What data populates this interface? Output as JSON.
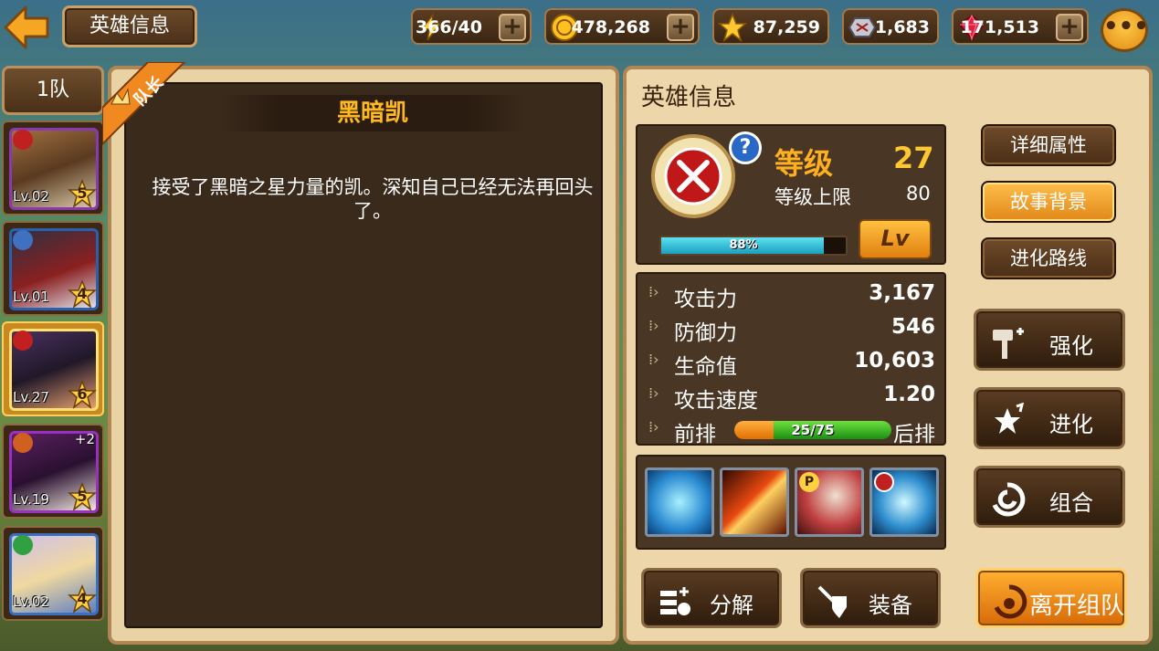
{
  "header": {
    "title": "英雄信息",
    "resources": {
      "stamina": "366/40",
      "gold": "478,268",
      "stars": "87,259",
      "crystal": "1,683",
      "ruby": "171,513"
    }
  },
  "sidebar": {
    "team_label": "1队",
    "heroes": [
      {
        "level": "Lv.02",
        "stars": "5",
        "extra": ""
      },
      {
        "level": "Lv.01",
        "stars": "4",
        "extra": ""
      },
      {
        "level": "Lv.27",
        "stars": "6",
        "extra": ""
      },
      {
        "level": "Lv.19",
        "stars": "5",
        "extra": "+2"
      },
      {
        "level": "Lv.02",
        "stars": "4",
        "extra": ""
      }
    ]
  },
  "story": {
    "captain_label": "队长",
    "hero_name": "黑暗凯",
    "text": "接受了黑暗之星力量的凯。深知自己已经无法再回头了。"
  },
  "info": {
    "title": "英雄信息",
    "level_label": "等级",
    "level_value": "27",
    "cap_label": "等级上限",
    "cap_value": "80",
    "xp_percent": "88%",
    "xp_fraction": 0.88,
    "lvup_label": "Lv",
    "stats": [
      {
        "label": "攻击力",
        "value": "3,167"
      },
      {
        "label": "防御力",
        "value": "546"
      },
      {
        "label": "生命值",
        "value": "10,603"
      },
      {
        "label": "攻击速度",
        "value": "1.20"
      }
    ],
    "position": {
      "front": "前排",
      "back": "后排",
      "value": "25/75",
      "front_fraction": 0.25
    }
  },
  "buttons": {
    "detail_attr": "详细属性",
    "story_bg": "故事背景",
    "evolve_route": "进化路线",
    "enhance": "强化",
    "evolve": "进化",
    "combine": "组合",
    "decompose": "分解",
    "equip": "装备",
    "leave_team": "离开组队"
  },
  "colors": {
    "accent": "#ffb820",
    "panel": "#ecd6aa",
    "dark_panel": "#4a3624"
  }
}
